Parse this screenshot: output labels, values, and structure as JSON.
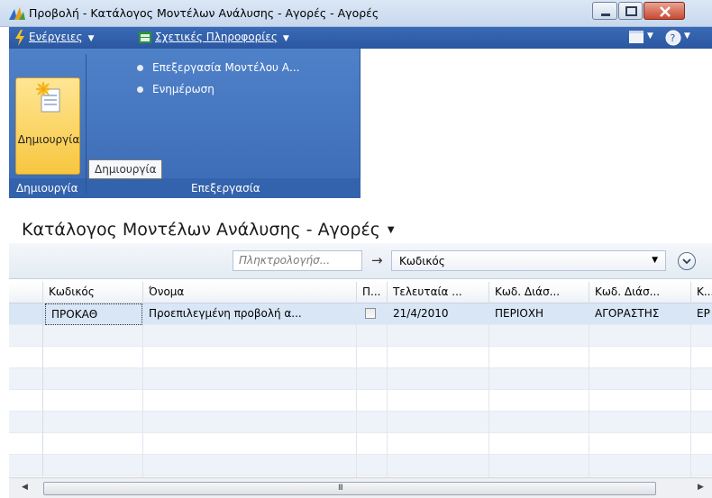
{
  "window": {
    "title": "Προβολή - Κατάλογος Μοντέλων Ανάλυσης - Αγορές - Αγορές"
  },
  "menubar": {
    "actions_label": "Ενέργειες",
    "related_info_label": "Σχετικές Πληροφορίες"
  },
  "ribbon": {
    "create_button_label": "Δημιουργία",
    "create_group_label": "Δημιουργία",
    "edit_group_label": "Επεξεργασία",
    "edit_model_label": "Επεξεργασία Μοντέλου Α...",
    "update_label": "Ενημέρωση",
    "tooltip": "Δημιουργία"
  },
  "list": {
    "title": "Κατάλογος Μοντέλων Ανάλυσης - Αγορές"
  },
  "filter": {
    "search_placeholder": "Πληκτρολογήσ...",
    "field_selected": "Κωδικός"
  },
  "table": {
    "columns": [
      "Κωδικός",
      "Όνομα",
      "Π...",
      "Τελευταία ...",
      "Κωδ. Διάσ...",
      "Κωδ. Διάσ...",
      "Κ..."
    ],
    "rows": [
      [
        "ΠΡΟΚΑΘ",
        "Προεπιλεγμένη προβολή α...",
        "",
        "21/4/2010",
        "ΠΕΡΙΟΧΗ",
        "ΑΓΟΡΑΣΤΗΣ",
        "ΕΡ"
      ]
    ]
  },
  "scrollbar": {
    "grip": "III"
  },
  "colors": {
    "ribbon_blue": "#3b6bb4",
    "menubar_blue": "#2b57a0",
    "create_button_yellow": "#f7c63f",
    "selected_row": "#d8e6f6"
  },
  "icons": [
    "app-icon",
    "minimize-icon",
    "maximize-icon",
    "close-icon",
    "lightning-icon",
    "info-table-icon",
    "layout-icon",
    "help-icon",
    "new-document-icon",
    "arrow-right-icon",
    "chevron-down-circle-icon"
  ]
}
